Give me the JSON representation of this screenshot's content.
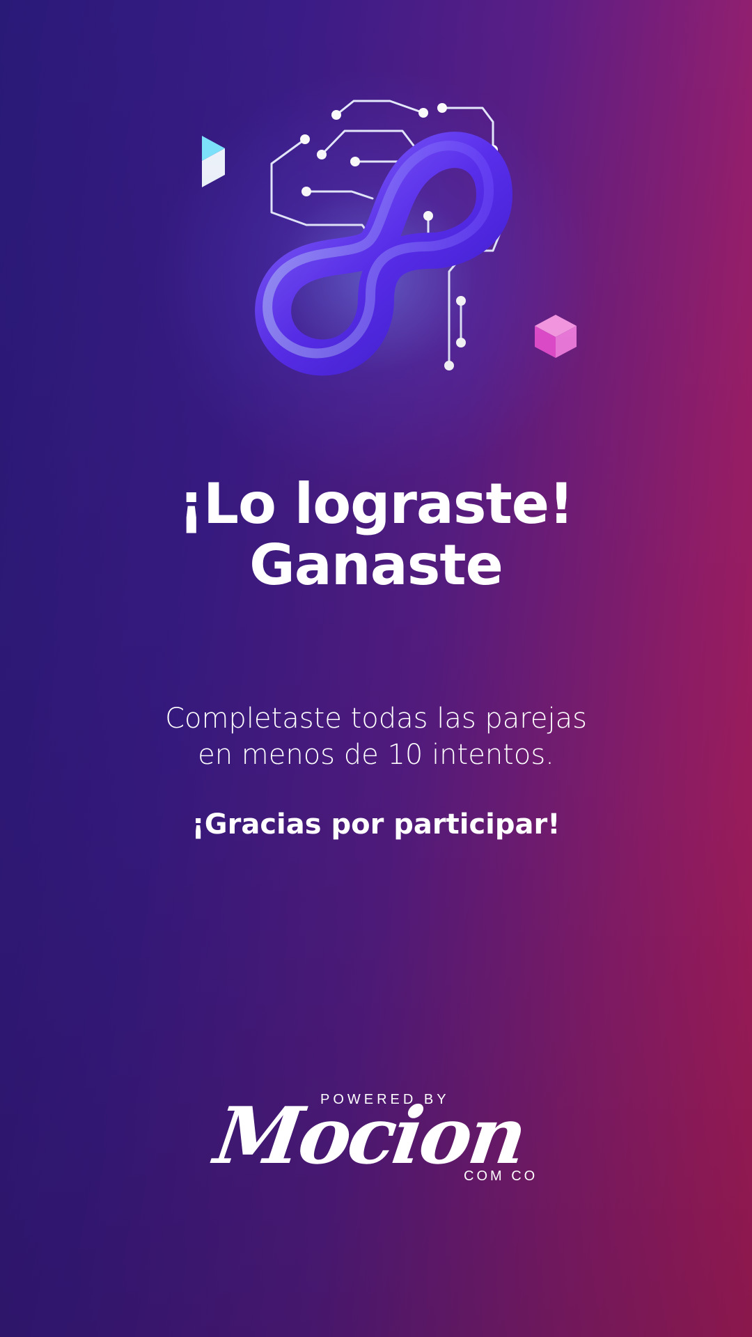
{
  "headline": {
    "line1": "¡Lo lograste!",
    "line2": "Ganaste"
  },
  "message": {
    "line1": "Completaste todas las parejas",
    "line2": "en menos de 10 intentos."
  },
  "thanks": "¡Gracias por participar!",
  "brand": {
    "powered_by": "POWERED BY",
    "name": "Mocion",
    "suffix": "COM CO"
  },
  "icons": {
    "hero": "infinity-circuit-icon",
    "cube_left": "cyan-cube-icon",
    "cube_right": "pink-cube-icon"
  },
  "colors": {
    "background_left": "#2a1a78",
    "background_right": "#c41f55",
    "infinity": "#6a3cff",
    "cube_cyan": "#33c6f0",
    "cube_pink": "#f06ad8",
    "text": "#ffffff"
  }
}
